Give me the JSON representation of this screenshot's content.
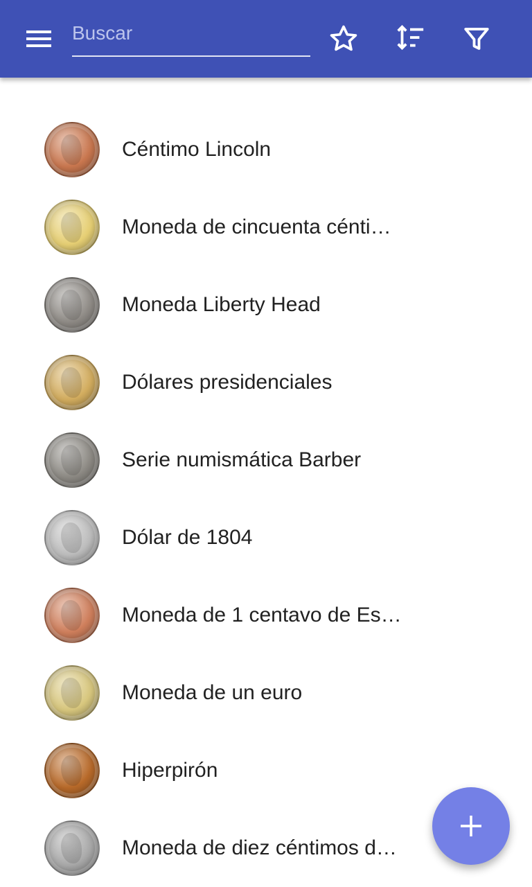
{
  "toolbar": {
    "background": "#3f51b5",
    "menu_icon": "hamburger-menu-icon",
    "search": {
      "placeholder": "Buscar",
      "value": ""
    },
    "actions": [
      {
        "icon": "star-outline-icon"
      },
      {
        "icon": "sort-icon"
      },
      {
        "icon": "filter-icon"
      }
    ]
  },
  "list": {
    "items": [
      {
        "label": "Céntimo Lincoln",
        "coin_color": "#c9774f"
      },
      {
        "label": "Moneda de cincuenta cénti…",
        "coin_color": "#e6cf74"
      },
      {
        "label": "Moneda Liberty Head",
        "coin_color": "#8f8b86"
      },
      {
        "label": "Dólares presidenciales",
        "coin_color": "#d3ad5f"
      },
      {
        "label": "Serie numismática Barber",
        "coin_color": "#8d8a84"
      },
      {
        "label": "Dólar de 1804",
        "coin_color": "#bdbdbd"
      },
      {
        "label": "Moneda de 1 centavo de Es…",
        "coin_color": "#cf7f5c"
      },
      {
        "label": "Moneda de un euro",
        "coin_color": "#d8c77e"
      },
      {
        "label": "Hiperpirón",
        "coin_color": "#b86a2a"
      },
      {
        "label": "Moneda de diez céntimos d…",
        "coin_color": "#a9a9a9"
      }
    ]
  },
  "fab": {
    "icon": "plus-icon",
    "color": "#7480e6"
  }
}
